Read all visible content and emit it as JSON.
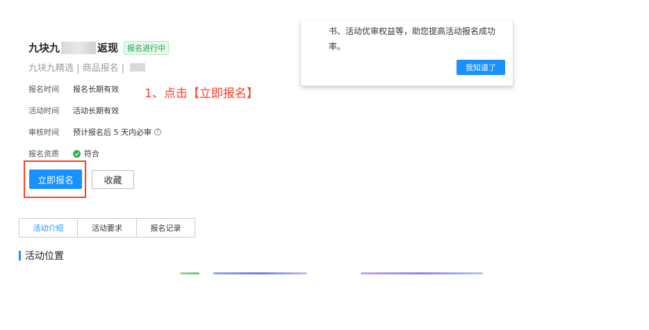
{
  "activity": {
    "title_prefix": "九块九",
    "title_suffix": "返现",
    "status_badge": "报名进行中",
    "subtitle": "九块九精选 | 商品报名 |"
  },
  "info": [
    {
      "label": "报名时间",
      "value": "报名长期有效"
    },
    {
      "label": "活动时间",
      "value": "活动长期有效"
    },
    {
      "label": "审核时间",
      "value": "预计报名后 5 天内必审"
    },
    {
      "label": "报名资质",
      "value": "符合"
    }
  ],
  "annotation": "1、点击【立即报名】",
  "buttons": {
    "signup": "立即报名",
    "favorite": "收藏"
  },
  "popover": {
    "text": "书、活动优审权益等，助您提高活动报名成功率。",
    "confirm": "我知道了"
  },
  "tabs": [
    "活动介绍",
    "活动要求",
    "报名记录"
  ],
  "section_title": "活动位置",
  "colors": {
    "primary": "#1890ff",
    "annotation": "#ff3b1f",
    "success": "#2bb14e"
  },
  "icons": [
    "help-circle-icon",
    "check-circle-icon"
  ]
}
